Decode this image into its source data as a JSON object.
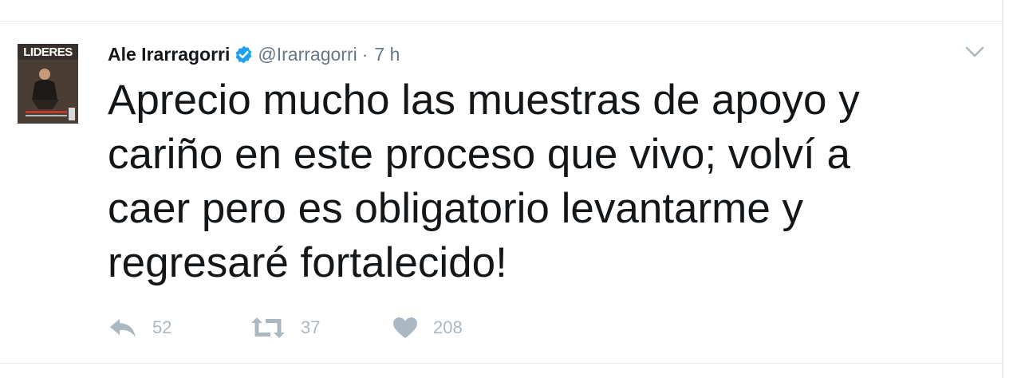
{
  "avatar": {
    "magazine_title": "LIDERES"
  },
  "author": {
    "name": "Ale Irarragorri",
    "handle": "@Irarragorri",
    "separator": "·",
    "time": "7 h"
  },
  "tweet": {
    "text": "Aprecio mucho las muestras de apoyo y\ncariño en este proceso que vivo; volví a\ncaer pero es obligatorio levantarme y\nregresaré fortalecido!"
  },
  "actions": {
    "reply_count": "52",
    "retweet_count": "37",
    "like_count": "208"
  },
  "icons": {
    "verified": "verified-badge-icon",
    "caret": "chevron-down-icon",
    "reply": "reply-icon",
    "retweet": "retweet-icon",
    "like": "heart-icon"
  },
  "colors": {
    "text": "#14171a",
    "secondary": "#657786",
    "action_gray": "#aab8c2",
    "verified_blue": "#1da1f2",
    "border": "#e6ecf0"
  }
}
